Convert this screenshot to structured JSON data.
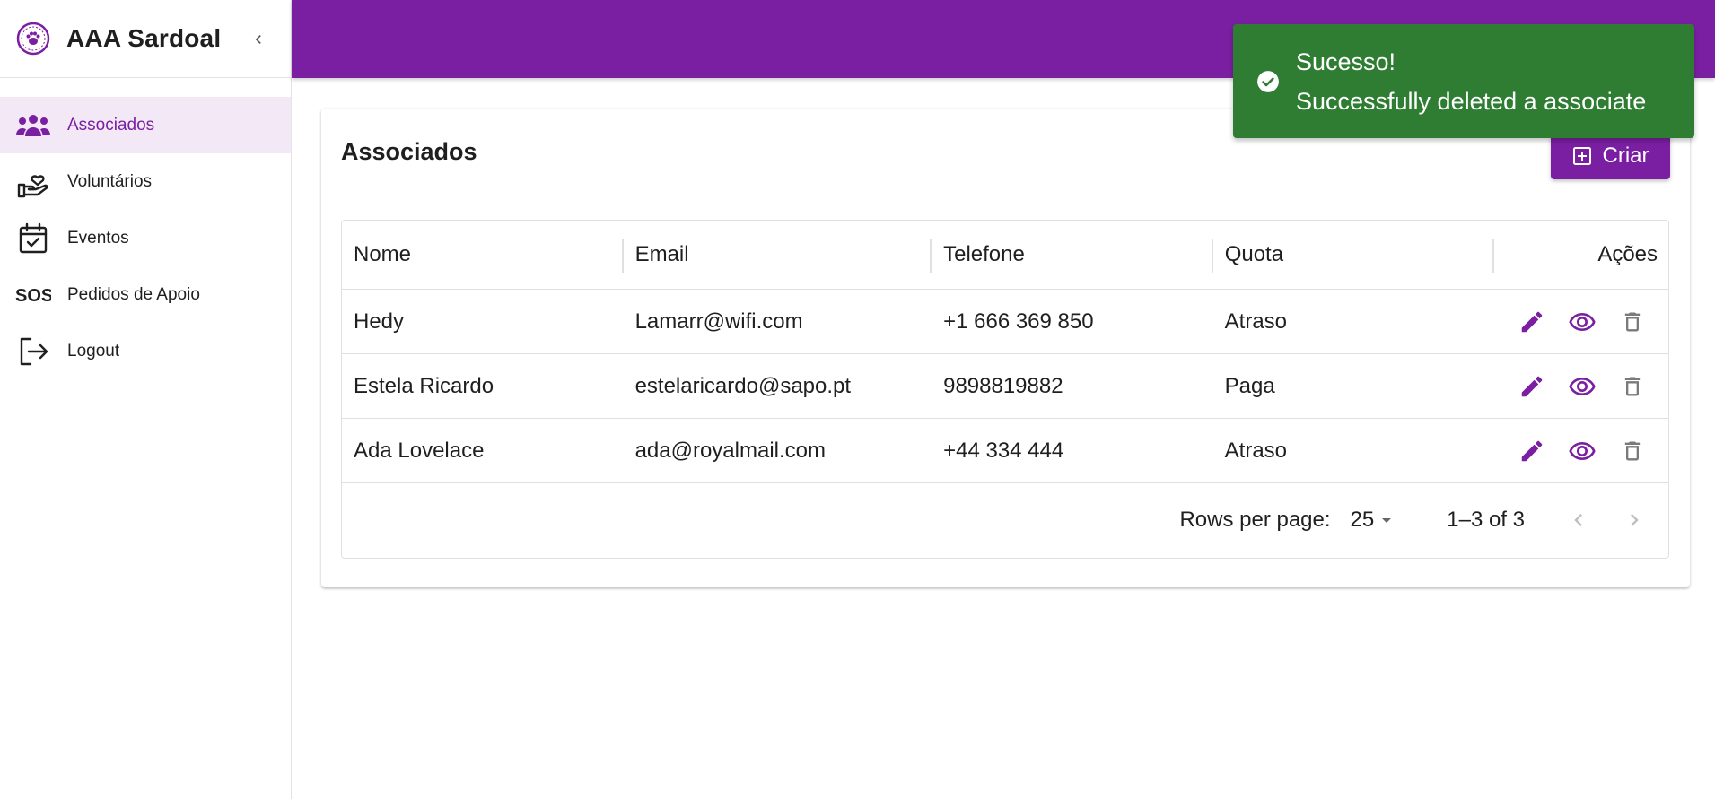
{
  "app": {
    "title": "AAA Sardoal"
  },
  "sidebar": {
    "items": [
      {
        "label": "Associados",
        "icon": "people-group-icon",
        "active": true
      },
      {
        "label": "Voluntários",
        "icon": "hand-heart-icon",
        "active": false
      },
      {
        "label": "Eventos",
        "icon": "calendar-check-icon",
        "active": false
      },
      {
        "label": "Pedidos de Apoio",
        "icon": "sos-icon",
        "active": false
      },
      {
        "label": "Logout",
        "icon": "logout-icon",
        "active": false
      }
    ]
  },
  "main": {
    "title": "Associados",
    "create_label": "Criar",
    "table": {
      "headers": [
        "Nome",
        "Email",
        "Telefone",
        "Quota",
        "Ações"
      ],
      "rows": [
        [
          "Hedy",
          "Lamarr@wifi.com",
          "+1 666 369 850",
          "Atraso"
        ],
        [
          "Estela Ricardo",
          "estelaricardo@sapo.pt",
          "9898819882",
          "Paga"
        ],
        [
          "Ada Lovelace",
          "ada@royalmail.com",
          "+44 334 444",
          "Atraso"
        ]
      ]
    },
    "pagination": {
      "rows_per_page_label": "Rows per page:",
      "rows_per_page": "25",
      "range": "1–3 of 3"
    }
  },
  "toast": {
    "title": "Sucesso!",
    "message": "Successfully deleted a associate"
  },
  "colors": {
    "primary": "#7b1fa2",
    "active_bg": "#f3e8f6",
    "success": "#2e7d32"
  }
}
